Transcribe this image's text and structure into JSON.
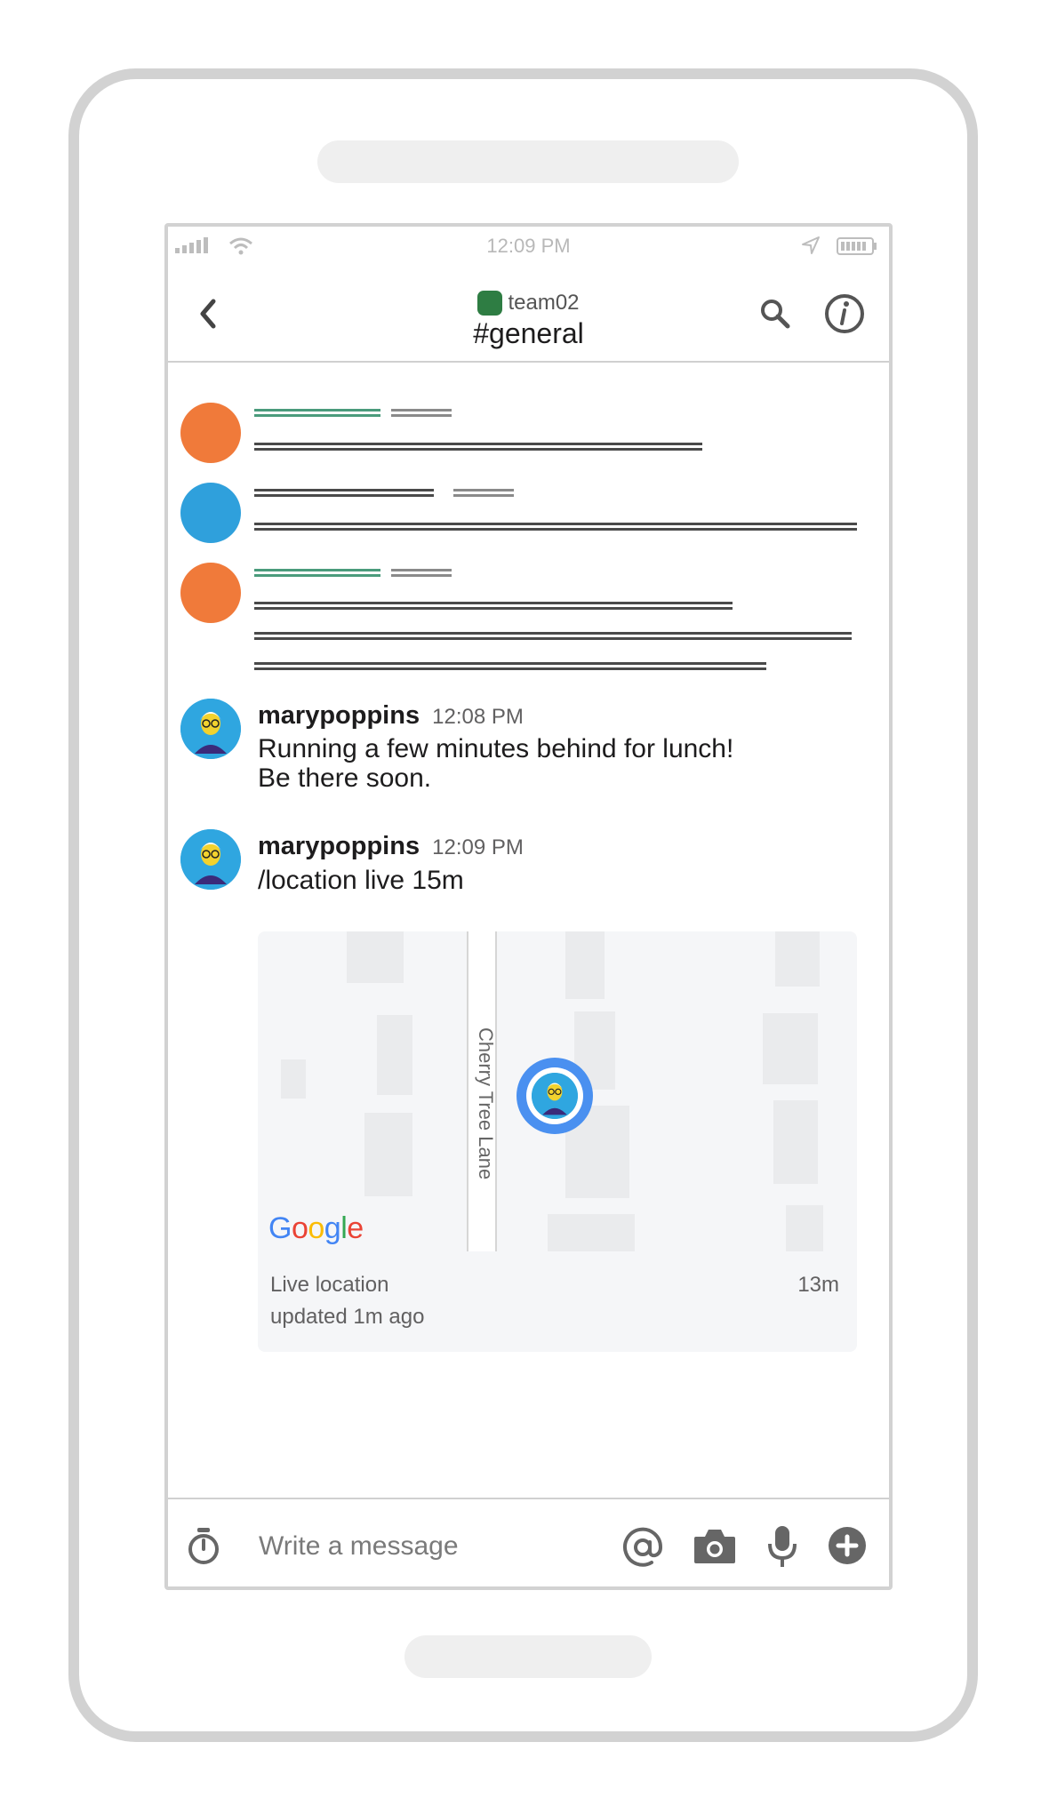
{
  "status_bar": {
    "time": "12:09 PM",
    "icons": [
      "signal-icon",
      "wifi-icon",
      "location-arrow-icon",
      "battery-icon"
    ]
  },
  "header": {
    "team_name": "team02",
    "team_color": "#2e7d43",
    "channel_name": "#general",
    "icons": [
      "back-chevron-icon",
      "search-icon",
      "info-icon"
    ]
  },
  "placeholder_colors": {
    "orange": "#f07a3a",
    "blue": "#2fa0dc",
    "green_line": "#4a9b7c"
  },
  "messages": [
    {
      "user": "marypoppins",
      "time": "12:08 PM",
      "lines": [
        "Running a few minutes behind for lunch!",
        "Be there soon."
      ]
    },
    {
      "user": "marypoppins",
      "time": "12:09 PM",
      "lines": [
        "/location live 15m"
      ]
    }
  ],
  "location_card": {
    "street": "Cherry Tree Lane",
    "logo": "Google",
    "status_line1": "Live location",
    "status_line2": "updated 1m ago",
    "distance": "13m",
    "pin_color": "#4a90f0"
  },
  "composer": {
    "placeholder": "Write a message",
    "icons": [
      "timer-icon",
      "mention-icon",
      "camera-icon",
      "microphone-icon",
      "plus-circle-icon"
    ]
  }
}
